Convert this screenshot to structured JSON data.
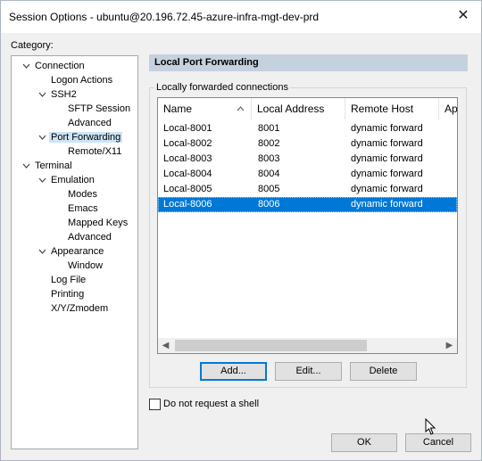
{
  "window": {
    "title": "Session Options - ubuntu@20.196.72.45-azure-infra-mgt-dev-prd",
    "close_glyph": "✕"
  },
  "category_label": "Category:",
  "tree": [
    {
      "label": "Connection",
      "depth": 0,
      "expanded": true
    },
    {
      "label": "Logon Actions",
      "depth": 1
    },
    {
      "label": "SSH2",
      "depth": 1,
      "expanded": true
    },
    {
      "label": "SFTP Session",
      "depth": 2
    },
    {
      "label": "Advanced",
      "depth": 2
    },
    {
      "label": "Port Forwarding",
      "depth": 1,
      "expanded": true,
      "selected": true
    },
    {
      "label": "Remote/X11",
      "depth": 2
    },
    {
      "label": "Terminal",
      "depth": 0,
      "expanded": true
    },
    {
      "label": "Emulation",
      "depth": 1,
      "expanded": true
    },
    {
      "label": "Modes",
      "depth": 2
    },
    {
      "label": "Emacs",
      "depth": 2
    },
    {
      "label": "Mapped Keys",
      "depth": 2
    },
    {
      "label": "Advanced",
      "depth": 2
    },
    {
      "label": "Appearance",
      "depth": 1,
      "expanded": true
    },
    {
      "label": "Window",
      "depth": 2
    },
    {
      "label": "Log File",
      "depth": 1
    },
    {
      "label": "Printing",
      "depth": 1
    },
    {
      "label": "X/Y/Zmodem",
      "depth": 1
    }
  ],
  "panel": {
    "header": "Local Port Forwarding",
    "group_label": "Locally forwarded connections",
    "columns": [
      "Name",
      "Local Address",
      "Remote Host",
      "Ap"
    ],
    "rows": [
      {
        "name": "Local-8001",
        "local": "8001",
        "remote": "dynamic forward",
        "selected": false
      },
      {
        "name": "Local-8002",
        "local": "8002",
        "remote": "dynamic forward",
        "selected": false
      },
      {
        "name": "Local-8003",
        "local": "8003",
        "remote": "dynamic forward",
        "selected": false
      },
      {
        "name": "Local-8004",
        "local": "8004",
        "remote": "dynamic forward",
        "selected": false
      },
      {
        "name": "Local-8005",
        "local": "8005",
        "remote": "dynamic forward",
        "selected": false
      },
      {
        "name": "Local-8006",
        "local": "8006",
        "remote": "dynamic forward",
        "selected": true
      }
    ],
    "buttons": {
      "add": "Add...",
      "edit": "Edit...",
      "delete": "Delete"
    }
  },
  "shell_checkbox": {
    "label": "Do not request a shell",
    "checked": false
  },
  "footer": {
    "ok": "OK",
    "cancel": "Cancel"
  },
  "colors": {
    "selection": "#0078d7",
    "header_bar": "#c6d1df",
    "tree_selected": "#cce4f7"
  }
}
